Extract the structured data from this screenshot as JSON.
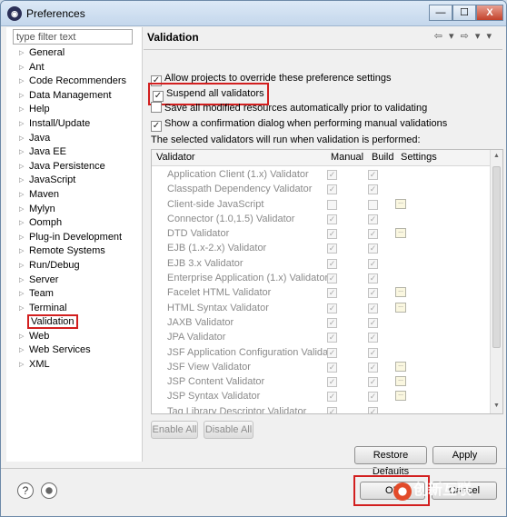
{
  "window": {
    "title": "Preferences",
    "controls": [
      "—",
      "☐",
      "X"
    ]
  },
  "filter": {
    "placeholder": "type filter text",
    "value": ""
  },
  "tree": [
    "General",
    "Ant",
    "Code Recommenders",
    "Data Management",
    "Help",
    "Install/Update",
    "Java",
    "Java EE",
    "Java Persistence",
    "JavaScript",
    "Maven",
    "Mylyn",
    "Oomph",
    "Plug-in Development",
    "Remote Systems",
    "Run/Debug",
    "Server",
    "Team",
    "Terminal",
    "Validation",
    "Web",
    "Web Services",
    "XML"
  ],
  "selected_tree_item": "Validation",
  "page": {
    "title": "Validation",
    "nav_icons": "⇦ ▾ ⇨ ▾ ▾"
  },
  "options": {
    "allow_override": {
      "label": "Allow projects to override these preference settings",
      "checked": true
    },
    "suspend_all": {
      "label": "Suspend all validators",
      "checked": true
    },
    "save_all": {
      "label": "Save all modified resources automatically prior to validating",
      "checked": false
    },
    "show_confirm": {
      "label": "Show a confirmation dialog when performing manual validations",
      "checked": true
    }
  },
  "table_caption": "The selected validators will run when validation is performed:",
  "table": {
    "headers": {
      "validator": "Validator",
      "manual": "Manual",
      "build": "Build",
      "settings": "Settings"
    },
    "rows": [
      {
        "name": "Application Client (1.x) Validator",
        "manual": true,
        "build": true,
        "settings": false
      },
      {
        "name": "Classpath Dependency Validator",
        "manual": true,
        "build": true,
        "settings": false
      },
      {
        "name": "Client-side JavaScript",
        "manual": false,
        "build": false,
        "settings": true
      },
      {
        "name": "Connector (1.0,1.5) Validator",
        "manual": true,
        "build": true,
        "settings": false
      },
      {
        "name": "DTD Validator",
        "manual": true,
        "build": true,
        "settings": true
      },
      {
        "name": "EJB (1.x-2.x) Validator",
        "manual": true,
        "build": true,
        "settings": false
      },
      {
        "name": "EJB 3.x Validator",
        "manual": true,
        "build": true,
        "settings": false
      },
      {
        "name": "Enterprise Application (1.x) Validator",
        "manual": true,
        "build": true,
        "settings": false
      },
      {
        "name": "Facelet HTML Validator",
        "manual": true,
        "build": true,
        "settings": true
      },
      {
        "name": "HTML Syntax Validator",
        "manual": true,
        "build": true,
        "settings": true
      },
      {
        "name": "JAXB Validator",
        "manual": true,
        "build": true,
        "settings": false
      },
      {
        "name": "JPA Validator",
        "manual": true,
        "build": true,
        "settings": false
      },
      {
        "name": "JSF Application Configuration Valida...",
        "manual": true,
        "build": true,
        "settings": false
      },
      {
        "name": "JSF View Validator",
        "manual": true,
        "build": true,
        "settings": true
      },
      {
        "name": "JSP Content Validator",
        "manual": true,
        "build": true,
        "settings": true
      },
      {
        "name": "JSP Syntax Validator",
        "manual": true,
        "build": true,
        "settings": true
      },
      {
        "name": "Tag Library Descriptor Validator",
        "manual": true,
        "build": true,
        "settings": false
      }
    ]
  },
  "buttons": {
    "enable_all": "Enable All",
    "disable_all": "Disable All",
    "restore_defaults": "Restore Defaults",
    "apply": "Apply",
    "ok": "OK",
    "cancel": "Cancel"
  },
  "footer": {
    "help": "?"
  },
  "watermark": "创新互联"
}
